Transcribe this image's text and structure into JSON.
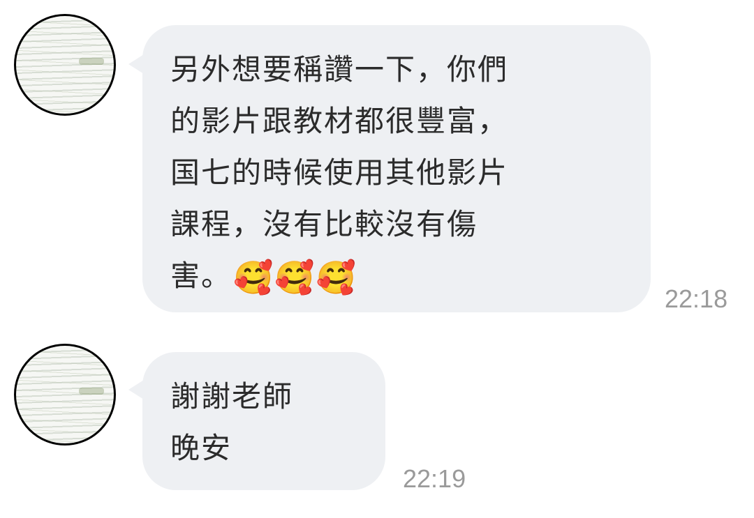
{
  "messages": [
    {
      "lines": [
        "另外想要稱讚一下，你們",
        "的影片跟教材都很豐富，",
        "国七的時候使用其他影片",
        "課程，沒有比較沒有傷",
        "害。"
      ],
      "emoji": "🥰🥰🥰",
      "time": "22:18",
      "avatar_icon": "profile-avatar"
    },
    {
      "lines": [
        "謝謝老師",
        "晚安"
      ],
      "time": "22:19",
      "avatar_icon": "profile-avatar"
    }
  ],
  "colors": {
    "bubble": "#eef0f3",
    "text": "#2b2b2b",
    "time": "#9a9a9a"
  }
}
